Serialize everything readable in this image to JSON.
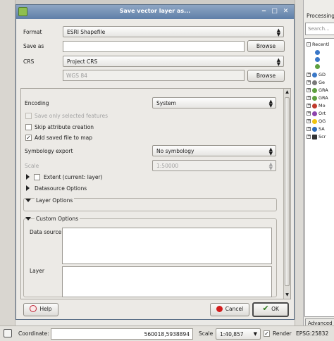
{
  "dialog": {
    "title": "Save vector layer as...",
    "format_label": "Format",
    "format_value": "ESRI Shapefile",
    "save_as_label": "Save as",
    "save_as_value": "",
    "browse_label": "Browse",
    "crs_label": "CRS",
    "crs_value": "Project CRS",
    "crs_text": "WGS 84",
    "browse2_label": "Browse"
  },
  "options": {
    "encoding_label": "Encoding",
    "encoding_value": "System",
    "save_selected_label": "Save only selected features",
    "save_selected_checked": false,
    "skip_attr_label": "Skip attribute creation",
    "skip_attr_checked": false,
    "add_to_map_label": "Add saved file to map",
    "add_to_map_checked": true,
    "symbology_label": "Symbology export",
    "symbology_value": "No symbology",
    "scale_label": "Scale",
    "scale_value": "1:50000",
    "extent_label": "Extent (current: layer)",
    "datasource_label": "Datasource Options",
    "layer_options_label": "Layer Options",
    "custom_options_label": "Custom Options",
    "data_source_label": "Data source",
    "layer_label": "Layer"
  },
  "buttons": {
    "help": "Help",
    "cancel": "Cancel",
    "ok": "OK"
  },
  "processing": {
    "title": "Processing T",
    "search_placeholder": "Search...",
    "tree": [
      {
        "label": "Recentl",
        "expander": "-",
        "color": "#ffffff"
      },
      {
        "label": "",
        "expander": "",
        "color": "#3a78c8"
      },
      {
        "label": "",
        "expander": "",
        "color": "#3a78c8"
      },
      {
        "label": "",
        "expander": "",
        "color": "#5fa040"
      },
      {
        "label": "GD",
        "expander": "+",
        "color": "#3a78c8"
      },
      {
        "label": "Ge",
        "expander": "+",
        "color": "#7a7a7a"
      },
      {
        "label": "GRA",
        "expander": "+",
        "color": "#5fa040"
      },
      {
        "label": "GRA",
        "expander": "+",
        "color": "#5fa040"
      },
      {
        "label": "Mo",
        "expander": "+",
        "color": "#c0392b"
      },
      {
        "label": "Ort",
        "expander": "+",
        "color": "#8e44ad"
      },
      {
        "label": "QG",
        "expander": "+",
        "color": "#f1c40f"
      },
      {
        "label": "SA",
        "expander": "+",
        "color": "#2e6bb8"
      },
      {
        "label": "Scr",
        "expander": "+",
        "color": "#333333"
      }
    ],
    "advanced_label": "Advanced in"
  },
  "statusbar": {
    "coordinate_label": "Coordinate:",
    "coordinate_value": "560018,5938894",
    "scale_label": "Scale",
    "scale_value": "1:40,857",
    "render_label": "Render",
    "render_checked": true,
    "epsg_label": "EPSG:25832"
  }
}
